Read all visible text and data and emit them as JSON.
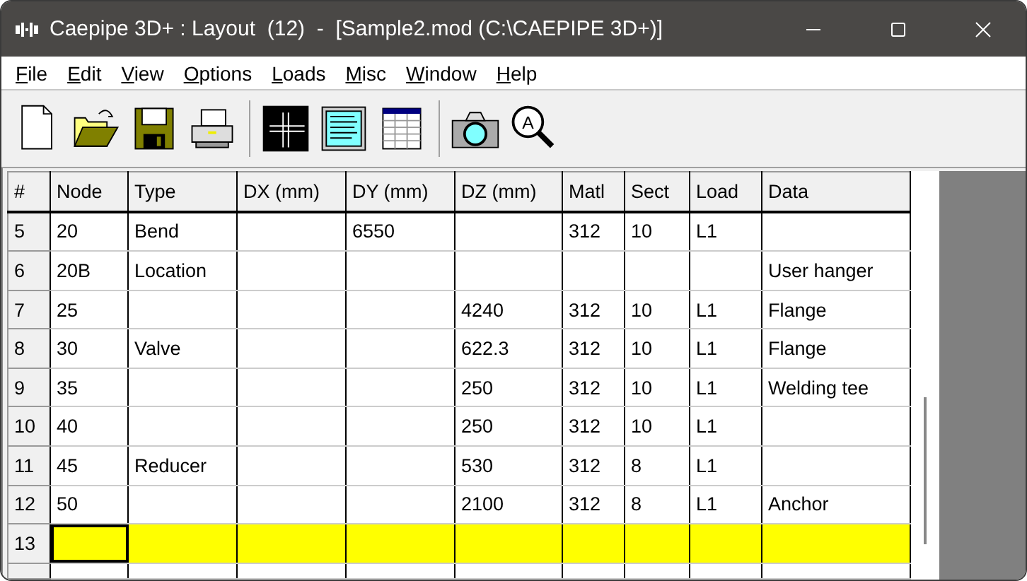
{
  "window": {
    "title": "Caepipe 3D+ : Layout  (12)  -  [Sample2.mod (C:\\CAEPIPE 3D+)]"
  },
  "menu": [
    {
      "label": "File"
    },
    {
      "label": "Edit"
    },
    {
      "label": "View"
    },
    {
      "label": "Options"
    },
    {
      "label": "Loads"
    },
    {
      "label": "Misc"
    },
    {
      "label": "Window"
    },
    {
      "label": "Help"
    }
  ],
  "toolbar": [
    {
      "kind": "new"
    },
    {
      "kind": "open"
    },
    {
      "kind": "save"
    },
    {
      "kind": "print"
    },
    {
      "kind": "separator"
    },
    {
      "kind": "crosshair"
    },
    {
      "kind": "textdoc"
    },
    {
      "kind": "table"
    },
    {
      "kind": "separator"
    },
    {
      "kind": "camera"
    },
    {
      "kind": "zoom",
      "glyph": "A"
    }
  ],
  "table": {
    "columns": [
      "#",
      "Node",
      "Type",
      "DX (mm)",
      "DY (mm)",
      "DZ (mm)",
      "Matl",
      "Sect",
      "Load",
      "Data"
    ],
    "rows": [
      {
        "cells": [
          "5",
          "20",
          "Bend",
          null,
          "6550",
          null,
          "312",
          "10",
          "L1",
          null
        ],
        "selected": false
      },
      {
        "cells": [
          "6",
          "20B",
          "Location",
          null,
          null,
          null,
          null,
          null,
          null,
          "User hanger"
        ],
        "selected": false
      },
      {
        "cells": [
          "7",
          "25",
          null,
          null,
          null,
          "4240",
          "312",
          "10",
          "L1",
          "Flange"
        ],
        "selected": false
      },
      {
        "cells": [
          "8",
          "30",
          "Valve",
          null,
          null,
          "622.3",
          "312",
          "10",
          "L1",
          "Flange"
        ],
        "selected": false
      },
      {
        "cells": [
          "9",
          "35",
          null,
          null,
          null,
          "250",
          "312",
          "10",
          "L1",
          "Welding tee"
        ],
        "selected": false
      },
      {
        "cells": [
          "10",
          "40",
          null,
          null,
          null,
          "250",
          "312",
          "10",
          "L1",
          null
        ],
        "selected": false
      },
      {
        "cells": [
          "11",
          "45",
          "Reducer",
          null,
          null,
          "530",
          "312",
          "8",
          "L1",
          null
        ],
        "selected": false
      },
      {
        "cells": [
          "12",
          "50",
          null,
          null,
          null,
          "2100",
          "312",
          "8",
          "L1",
          "Anchor"
        ],
        "selected": false
      },
      {
        "cells": [
          "13"
        ],
        "selected": true
      }
    ]
  }
}
